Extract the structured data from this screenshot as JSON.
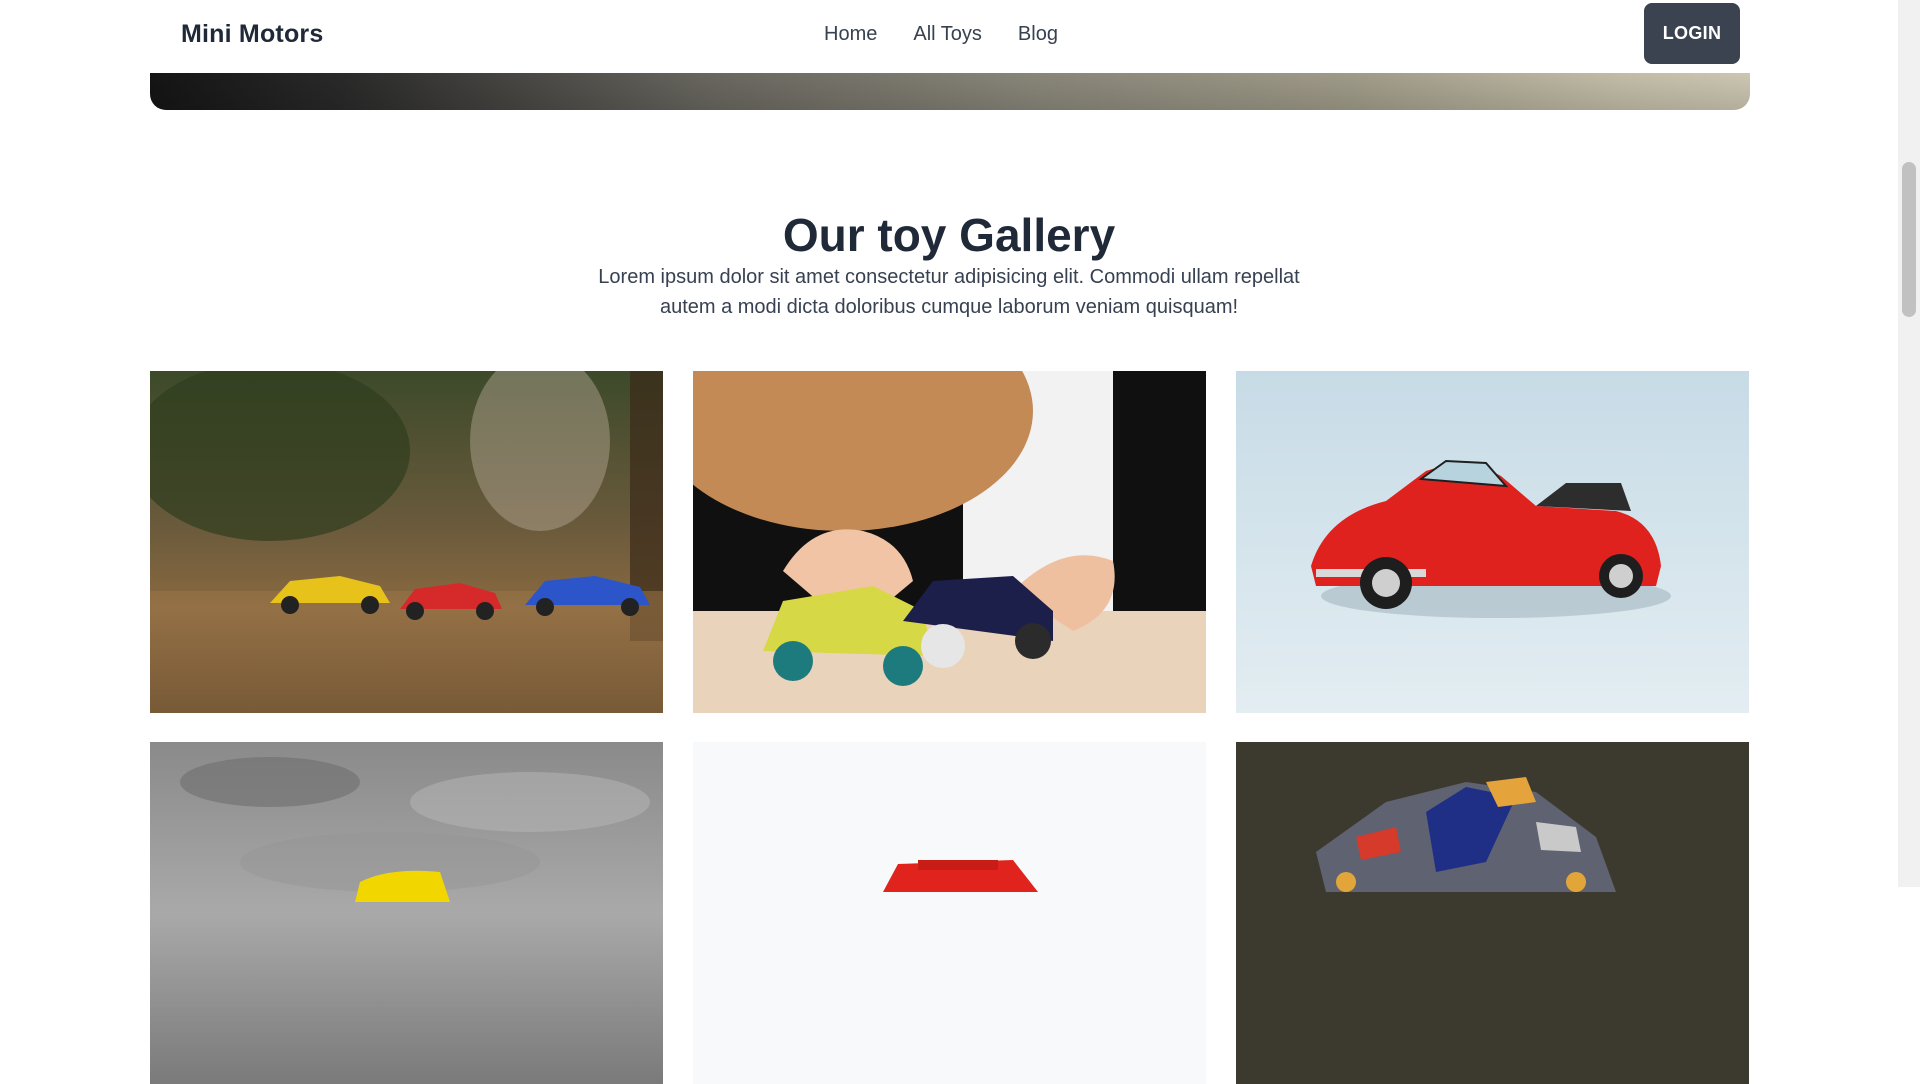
{
  "nav": {
    "brand": "Mini Motors",
    "links": [
      "Home",
      "All Toys",
      "Blog"
    ],
    "login_label": "LOGIN"
  },
  "gallery": {
    "title": "Our toy Gallery",
    "description": "Lorem ipsum dolor sit amet consectetur adipisicing elit. Commodi ullam repellat autem a modi dicta doloribus cumque laborum veniam quisquam!",
    "images": [
      {
        "icon": "three-toy-cars-photo"
      },
      {
        "icon": "child-playing-toy-cars-photo"
      },
      {
        "icon": "red-convertible-beetle-photo"
      },
      {
        "icon": "yellow-toy-car-on-sand-photo"
      },
      {
        "icon": "red-toy-jeep-photo"
      },
      {
        "icon": "mini-4wd-racer-photo"
      }
    ]
  },
  "colors": {
    "brand_text": "#1f2937",
    "login_button": "#3b4250"
  }
}
